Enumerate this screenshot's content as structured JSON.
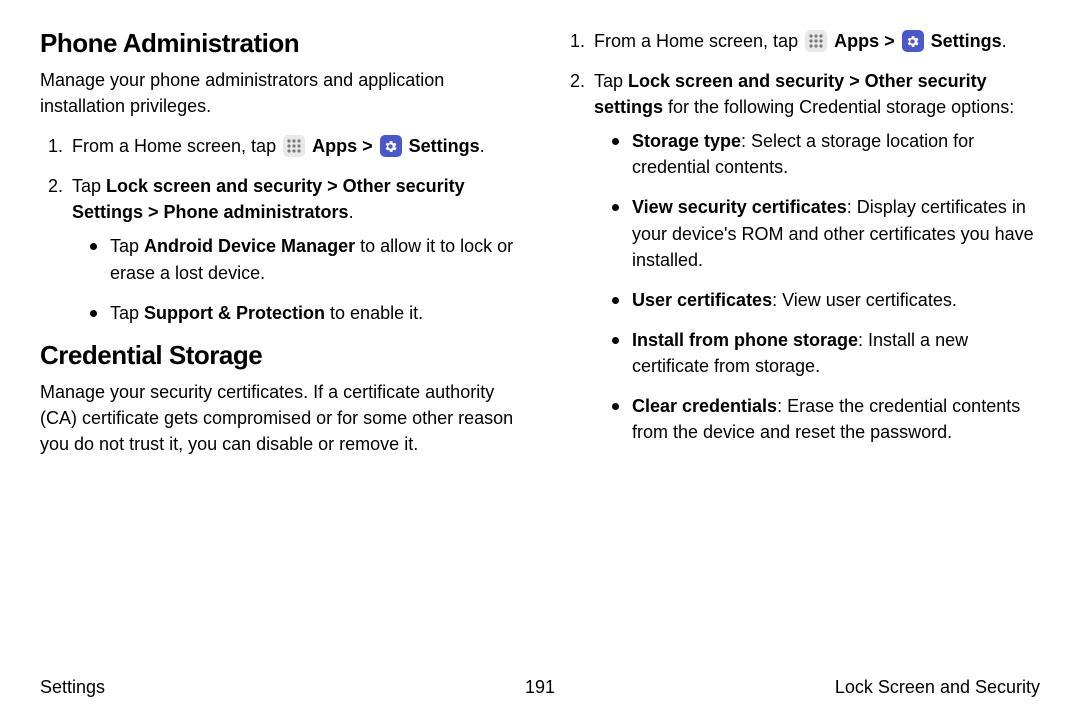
{
  "left": {
    "sec1": {
      "heading": "Phone Administration",
      "desc": "Manage your phone administrators and application installation privileges.",
      "step1_pre": "From a Home screen, tap ",
      "step1_apps": "Apps",
      "step1_sep": " > ",
      "step1_settings": "Settings",
      "step1_post": ".",
      "step2_pre": "Tap ",
      "step2_bold": "Lock screen and security > Other security Settings > Phone administrators",
      "step2_post": ".",
      "b1_pre": "Tap ",
      "b1_bold": "Android Device Manager",
      "b1_post": " to allow it to lock or erase a lost device.",
      "b2_pre": "Tap ",
      "b2_bold": "Support & Protection",
      "b2_post": " to enable it."
    },
    "sec2": {
      "heading": "Credential Storage",
      "desc": "Manage your security certificates. If a certificate authority (CA) certificate gets compromised or for some other reason you do not trust it, you can disable or remove it."
    }
  },
  "right": {
    "step1_pre": "From a Home screen, tap ",
    "step1_apps": "Apps",
    "step1_sep": " > ",
    "step1_settings": "Settings",
    "step1_post": ".",
    "step2_pre": "Tap ",
    "step2_bold": "Lock screen and security > Other security settings",
    "step2_post": " for the following Credential storage options:",
    "opts": {
      "o1b": "Storage type",
      "o1t": ": Select a storage location for credential contents.",
      "o2b": "View security certificates",
      "o2t": ": Display certificates in your device's ROM and other certificates you have installed.",
      "o3b": "User certificates",
      "o3t": ": View user certificates.",
      "o4b": "Install from phone storage",
      "o4t": ": Install a new certificate from storage.",
      "o5b": "Clear credentials",
      "o5t": ": Erase the credential contents from the device and reset the password."
    }
  },
  "footer": {
    "left": "Settings",
    "center": "191",
    "right": "Lock Screen and Security"
  },
  "icons": {
    "apps": "apps-icon",
    "settings": "settings-icon"
  }
}
